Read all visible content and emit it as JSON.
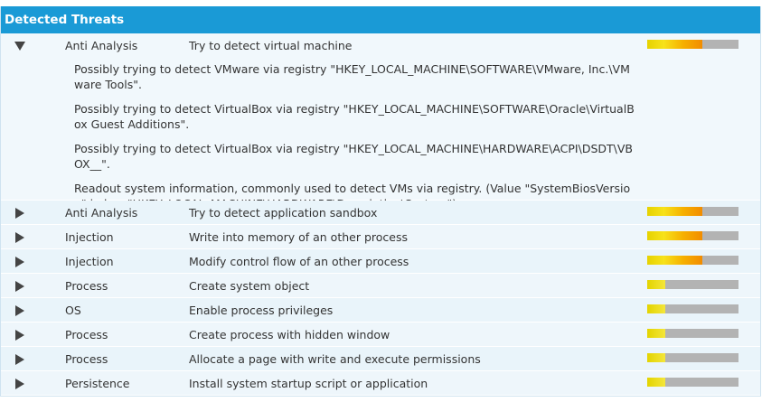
{
  "panel": {
    "title": "Detected Threats"
  },
  "threats": [
    {
      "category": "Anti Analysis",
      "description": "Try to detect virtual machine",
      "severity": 0.6,
      "expanded": true,
      "details": [
        "Possibly trying to detect VMware via registry \"HKEY_LOCAL_MACHINE\\SOFTWARE\\VMware, Inc.\\VMware Tools\".",
        "Possibly trying to detect VirtualBox via registry \"HKEY_LOCAL_MACHINE\\SOFTWARE\\Oracle\\VirtualBox Guest Additions\".",
        "Possibly trying to detect VirtualBox via registry \"HKEY_LOCAL_MACHINE\\HARDWARE\\ACPI\\DSDT\\VBOX__\".",
        "Readout system information, commonly used to detect VMs via registry. (Value \"SystemBiosVersion\" in key \"HKEY_LOCAL_MACHINE\\HARDWARE\\Description\\System\")."
      ]
    },
    {
      "category": "Anti Analysis",
      "description": "Try to detect application sandbox",
      "severity": 0.6,
      "expanded": false
    },
    {
      "category": "Injection",
      "description": "Write into memory of an other process",
      "severity": 0.6,
      "expanded": false
    },
    {
      "category": "Injection",
      "description": "Modify control flow of an other process",
      "severity": 0.6,
      "expanded": false
    },
    {
      "category": "Process",
      "description": "Create system object",
      "severity": 0.2,
      "expanded": false
    },
    {
      "category": "OS",
      "description": "Enable process privileges",
      "severity": 0.2,
      "expanded": false
    },
    {
      "category": "Process",
      "description": "Create process with hidden window",
      "severity": 0.2,
      "expanded": false
    },
    {
      "category": "Process",
      "description": "Allocate a page with write and execute permissions",
      "severity": 0.2,
      "expanded": false
    },
    {
      "category": "Persistence",
      "description": "Install system startup script or application",
      "severity": 0.2,
      "expanded": false
    }
  ]
}
